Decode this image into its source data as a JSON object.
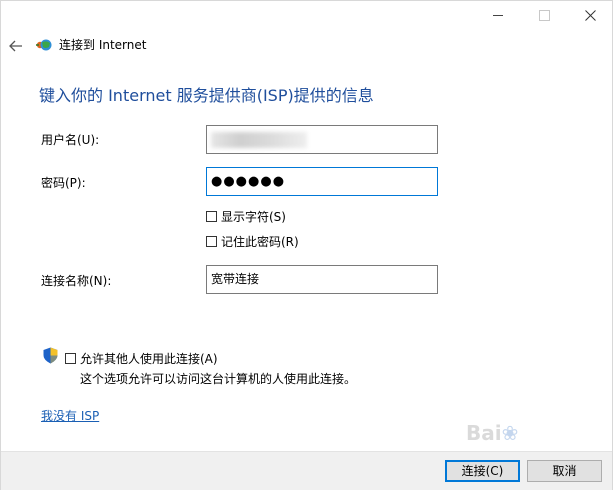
{
  "window": {
    "title": "连接到 Internet"
  },
  "heading": "键入你的 Internet 服务提供商(ISP)提供的信息",
  "form": {
    "username_label": "用户名(U):",
    "password_label": "密码(P):",
    "password_value": "●●●●●●",
    "show_chars_label": "显示字符(S)",
    "remember_password_label": "记住此密码(R)",
    "connection_name_label": "连接名称(N):",
    "connection_name_value": "宽带连接"
  },
  "allow_others": {
    "label": "允许其他人使用此连接(A)",
    "description": "这个选项允许可以访问这台计算机的人使用此连接。"
  },
  "no_isp_link": "我没有 ISP",
  "buttons": {
    "connect": "连接(C)",
    "cancel": "取消"
  },
  "colors": {
    "heading": "#1f4e9c",
    "link": "#1a5fb4",
    "focus_border": "#0078d7",
    "footer_bg": "#f0f0f0"
  }
}
